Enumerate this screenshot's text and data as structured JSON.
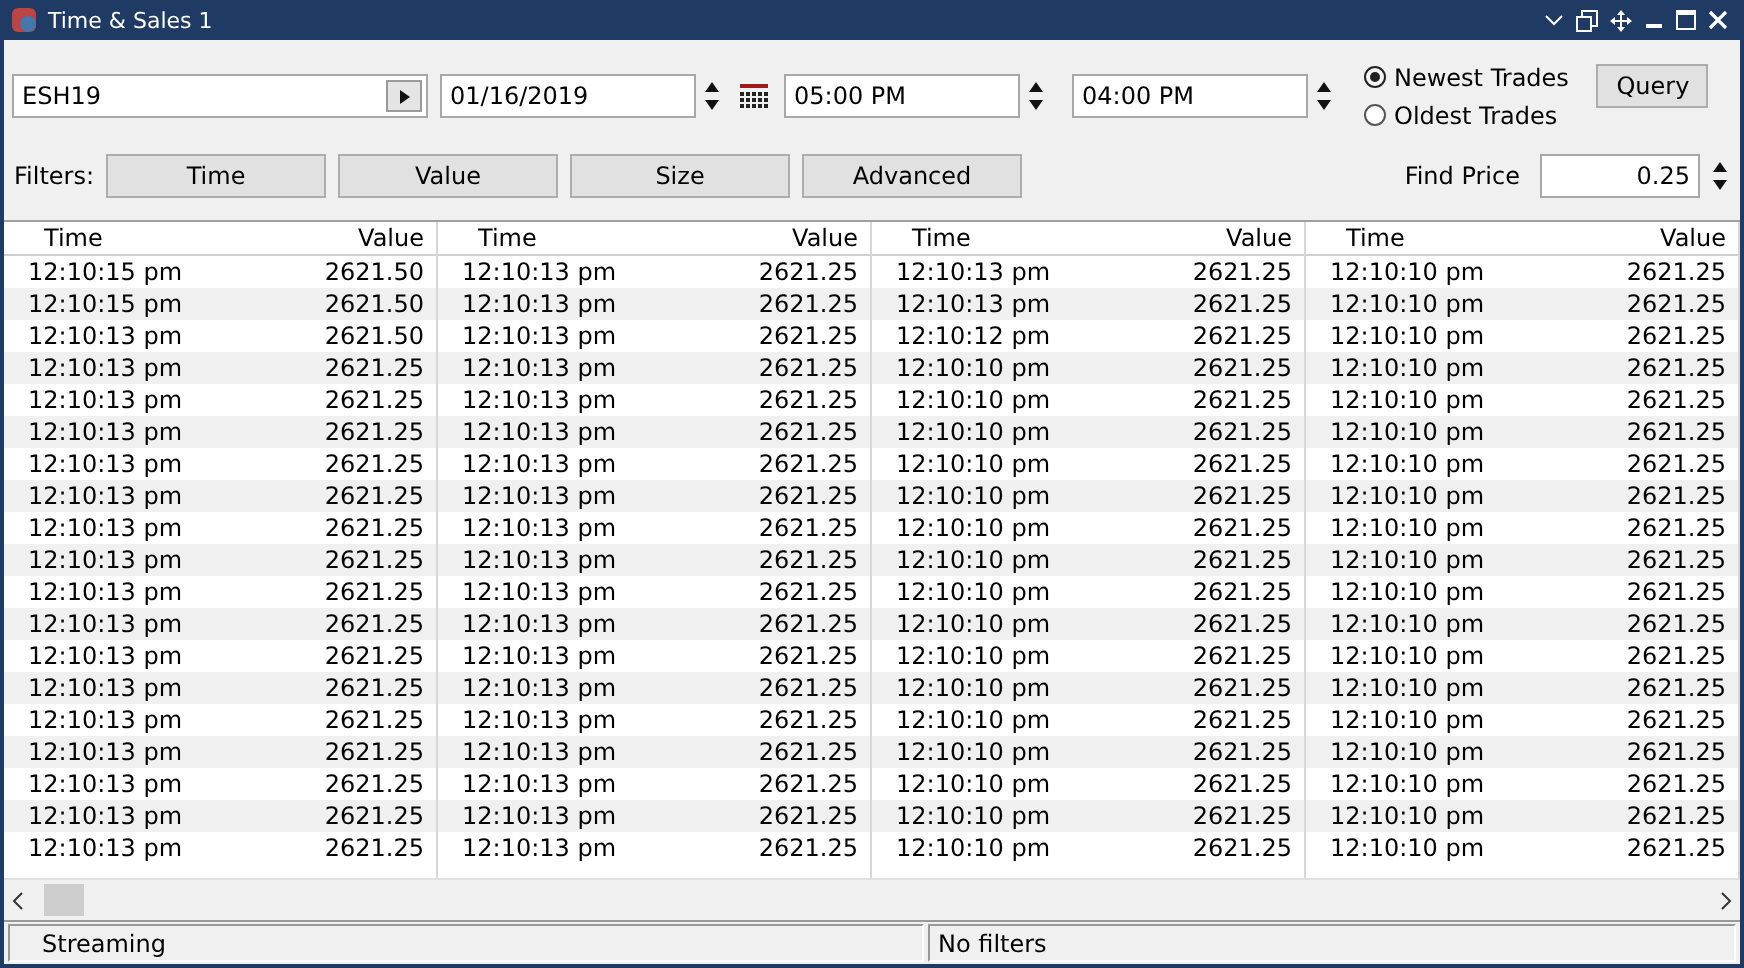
{
  "window": {
    "title": "Time & Sales 1"
  },
  "query": {
    "symbol": "ESH19",
    "date": "01/16/2019",
    "start_time": "05:00 PM",
    "end_time": "04:00 PM",
    "button": "Query"
  },
  "order": [
    {
      "label": "Newest Trades",
      "selected": true
    },
    {
      "label": "Oldest Trades",
      "selected": false
    }
  ],
  "filters": {
    "label": "Filters:",
    "buttons": [
      "Time",
      "Value",
      "Size",
      "Advanced"
    ]
  },
  "find_price": {
    "label": "Find Price",
    "value": "0.25"
  },
  "table": {
    "groups": [
      {
        "columns": [
          "Time",
          "Value"
        ],
        "rows": [
          [
            "12:10:15 pm",
            "2621.50"
          ],
          [
            "12:10:15 pm",
            "2621.50"
          ],
          [
            "12:10:13 pm",
            "2621.50"
          ],
          [
            "12:10:13 pm",
            "2621.25"
          ],
          [
            "12:10:13 pm",
            "2621.25"
          ],
          [
            "12:10:13 pm",
            "2621.25"
          ],
          [
            "12:10:13 pm",
            "2621.25"
          ],
          [
            "12:10:13 pm",
            "2621.25"
          ],
          [
            "12:10:13 pm",
            "2621.25"
          ],
          [
            "12:10:13 pm",
            "2621.25"
          ],
          [
            "12:10:13 pm",
            "2621.25"
          ],
          [
            "12:10:13 pm",
            "2621.25"
          ],
          [
            "12:10:13 pm",
            "2621.25"
          ],
          [
            "12:10:13 pm",
            "2621.25"
          ],
          [
            "12:10:13 pm",
            "2621.25"
          ],
          [
            "12:10:13 pm",
            "2621.25"
          ],
          [
            "12:10:13 pm",
            "2621.25"
          ],
          [
            "12:10:13 pm",
            "2621.25"
          ],
          [
            "12:10:13 pm",
            "2621.25"
          ]
        ]
      },
      {
        "columns": [
          "Time",
          "Value"
        ],
        "rows": [
          [
            "12:10:13 pm",
            "2621.25"
          ],
          [
            "12:10:13 pm",
            "2621.25"
          ],
          [
            "12:10:13 pm",
            "2621.25"
          ],
          [
            "12:10:13 pm",
            "2621.25"
          ],
          [
            "12:10:13 pm",
            "2621.25"
          ],
          [
            "12:10:13 pm",
            "2621.25"
          ],
          [
            "12:10:13 pm",
            "2621.25"
          ],
          [
            "12:10:13 pm",
            "2621.25"
          ],
          [
            "12:10:13 pm",
            "2621.25"
          ],
          [
            "12:10:13 pm",
            "2621.25"
          ],
          [
            "12:10:13 pm",
            "2621.25"
          ],
          [
            "12:10:13 pm",
            "2621.25"
          ],
          [
            "12:10:13 pm",
            "2621.25"
          ],
          [
            "12:10:13 pm",
            "2621.25"
          ],
          [
            "12:10:13 pm",
            "2621.25"
          ],
          [
            "12:10:13 pm",
            "2621.25"
          ],
          [
            "12:10:13 pm",
            "2621.25"
          ],
          [
            "12:10:13 pm",
            "2621.25"
          ],
          [
            "12:10:13 pm",
            "2621.25"
          ]
        ]
      },
      {
        "columns": [
          "Time",
          "Value"
        ],
        "rows": [
          [
            "12:10:13 pm",
            "2621.25"
          ],
          [
            "12:10:13 pm",
            "2621.25"
          ],
          [
            "12:10:12 pm",
            "2621.25"
          ],
          [
            "12:10:10 pm",
            "2621.25"
          ],
          [
            "12:10:10 pm",
            "2621.25"
          ],
          [
            "12:10:10 pm",
            "2621.25"
          ],
          [
            "12:10:10 pm",
            "2621.25"
          ],
          [
            "12:10:10 pm",
            "2621.25"
          ],
          [
            "12:10:10 pm",
            "2621.25"
          ],
          [
            "12:10:10 pm",
            "2621.25"
          ],
          [
            "12:10:10 pm",
            "2621.25"
          ],
          [
            "12:10:10 pm",
            "2621.25"
          ],
          [
            "12:10:10 pm",
            "2621.25"
          ],
          [
            "12:10:10 pm",
            "2621.25"
          ],
          [
            "12:10:10 pm",
            "2621.25"
          ],
          [
            "12:10:10 pm",
            "2621.25"
          ],
          [
            "12:10:10 pm",
            "2621.25"
          ],
          [
            "12:10:10 pm",
            "2621.25"
          ],
          [
            "12:10:10 pm",
            "2621.25"
          ]
        ]
      },
      {
        "columns": [
          "Time",
          "Value"
        ],
        "rows": [
          [
            "12:10:10 pm",
            "2621.25"
          ],
          [
            "12:10:10 pm",
            "2621.25"
          ],
          [
            "12:10:10 pm",
            "2621.25"
          ],
          [
            "12:10:10 pm",
            "2621.25"
          ],
          [
            "12:10:10 pm",
            "2621.25"
          ],
          [
            "12:10:10 pm",
            "2621.25"
          ],
          [
            "12:10:10 pm",
            "2621.25"
          ],
          [
            "12:10:10 pm",
            "2621.25"
          ],
          [
            "12:10:10 pm",
            "2621.25"
          ],
          [
            "12:10:10 pm",
            "2621.25"
          ],
          [
            "12:10:10 pm",
            "2621.25"
          ],
          [
            "12:10:10 pm",
            "2621.25"
          ],
          [
            "12:10:10 pm",
            "2621.25"
          ],
          [
            "12:10:10 pm",
            "2621.25"
          ],
          [
            "12:10:10 pm",
            "2621.25"
          ],
          [
            "12:10:10 pm",
            "2621.25"
          ],
          [
            "12:10:10 pm",
            "2621.25"
          ],
          [
            "12:10:10 pm",
            "2621.25"
          ],
          [
            "12:10:10 pm",
            "2621.25"
          ]
        ]
      }
    ]
  },
  "status_bar": [
    "Streaming",
    "No filters"
  ]
}
